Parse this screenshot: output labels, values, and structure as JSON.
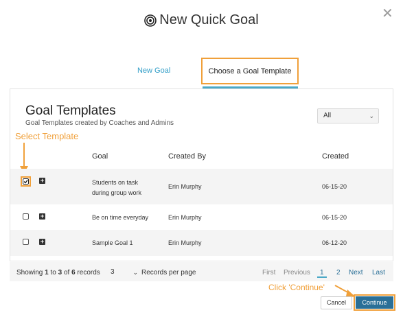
{
  "modal": {
    "title": "New Quick Goal",
    "close_icon": "close-icon"
  },
  "tabs": [
    {
      "label": "New Goal"
    },
    {
      "label": "Choose a Goal Template",
      "active": true
    }
  ],
  "panel": {
    "title": "Goal Templates",
    "subtitle": "Goal Templates created by Coaches and Admins",
    "filter": {
      "selected": "All"
    }
  },
  "annotations": {
    "select_template": "Select Template",
    "click_continue": "Click 'Continue'"
  },
  "table": {
    "columns": [
      "Goal",
      "Created By",
      "Created"
    ],
    "rows": [
      {
        "goal_line1": "Students on task",
        "goal_line2": "during group work",
        "created_by": "Erin Murphy",
        "created": "06-15-20",
        "checked": true
      },
      {
        "goal": "Be on time everyday",
        "created_by": "Erin Murphy",
        "created": "06-15-20",
        "checked": false
      },
      {
        "goal": "Sample Goal 1",
        "created_by": "Erin Murphy",
        "created": "06-12-20",
        "checked": false
      }
    ]
  },
  "footer": {
    "showing_prefix": "Showing",
    "from": "1",
    "to_word": "to",
    "to": "3",
    "of_word": "of",
    "total": "6",
    "records_word": "records",
    "per_page": "3",
    "per_page_label": "Records per page",
    "pagination": {
      "first": "First",
      "previous": "Previous",
      "page1": "1",
      "page2": "2",
      "next": "Next",
      "last": "Last"
    }
  },
  "buttons": {
    "cancel": "Cancel",
    "continue": "Continue"
  },
  "colors": {
    "accent": "#2a6f97",
    "highlight": "#f0a03a",
    "tab_underline": "#4aa8c7"
  }
}
